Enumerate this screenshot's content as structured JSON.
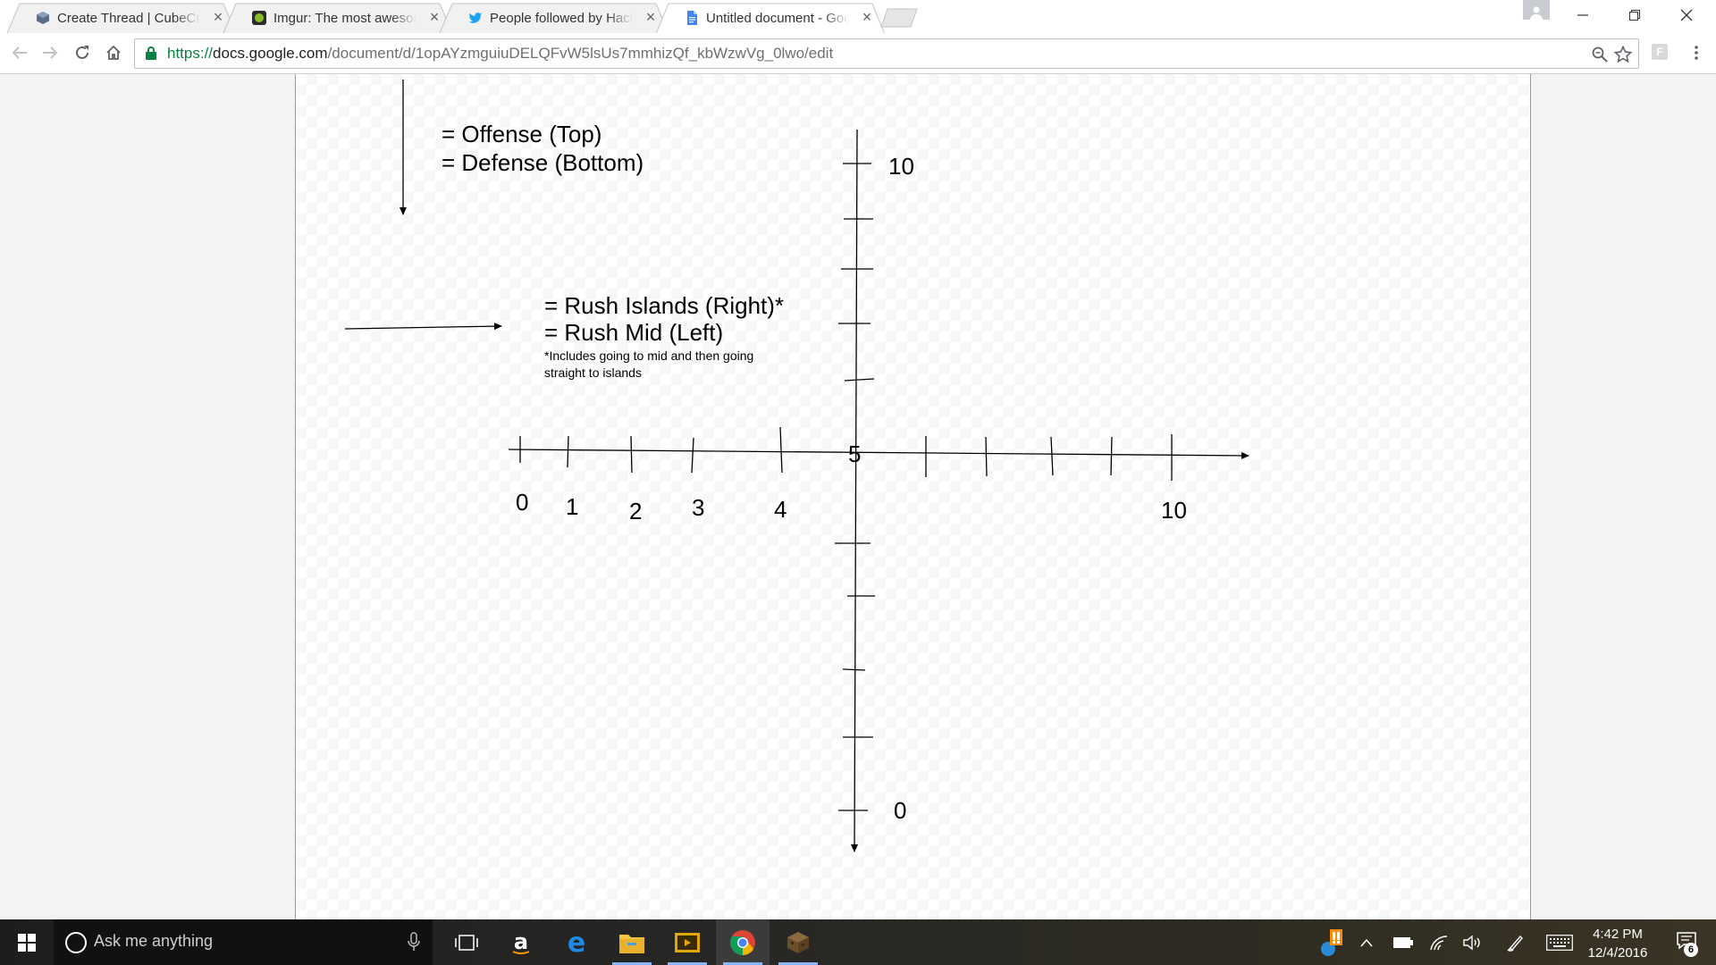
{
  "tabs": [
    {
      "title": "Create Thread | CubeCraft",
      "icon": "cubecraft-icon",
      "active": false
    },
    {
      "title": "Imgur: The most awesome",
      "icon": "imgur-icon",
      "active": false
    },
    {
      "title": "People followed by Hacker",
      "icon": "twitter-icon",
      "active": false
    },
    {
      "title": "Untitled document - Google Docs",
      "icon": "google-docs-icon",
      "active": true
    }
  ],
  "address_bar": {
    "scheme": "https://",
    "host": "docs.google.com",
    "path": "/document/d/1opAYzmguiuDELQFvW5lsUs7mmhizQf_kbWzwVg_0lwo/edit"
  },
  "extension_badge": "F",
  "drawing": {
    "legend_vertical": [
      "= Offense (Top)",
      "= Defense (Bottom)"
    ],
    "legend_horizontal": [
      "= Rush Islands (Right)*",
      "= Rush Mid (Left)"
    ],
    "footnote": [
      "*Includes going to mid and then going",
      "straight to islands"
    ],
    "x_axis_labels": [
      "0",
      "1",
      "2",
      "3",
      "4",
      "5",
      "10"
    ],
    "y_axis_top_label": "10",
    "y_axis_bottom_label": "0"
  },
  "taskbar": {
    "search_placeholder": "Ask me anything",
    "time": "4:42 PM",
    "date": "12/4/2016",
    "notification_count": "6"
  }
}
